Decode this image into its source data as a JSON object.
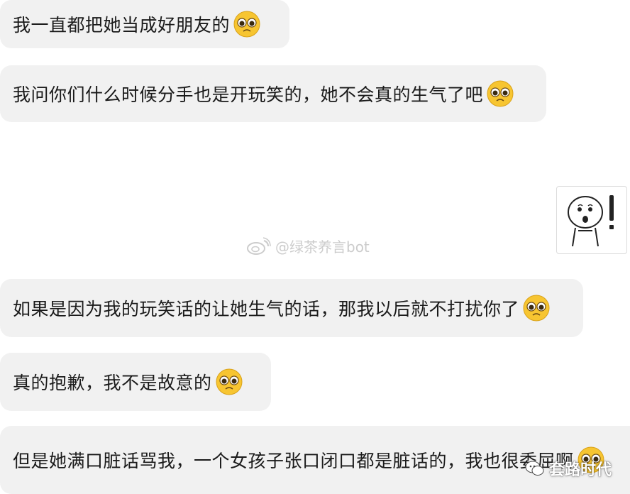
{
  "messages": [
    {
      "text": "我一直都把她当成好朋友的",
      "emoji": "crying-emoji"
    },
    {
      "text": "我问你们什么时候分手也是开玩笑的，她不会真的生气了吧",
      "emoji": "crying-emoji"
    },
    {
      "text": "如果是因为我的玩笑话的让她生气的话，那我以后就不打扰你了",
      "emoji": "crying-emoji"
    },
    {
      "text": "真的抱歉，我不是故意的",
      "emoji": "crying-emoji"
    },
    {
      "text": "但是她满口脏话骂我，一个女孩子张口闭口都是脏话的，我也很委屈啊",
      "emoji": "crying-emoji"
    }
  ],
  "sticker": {
    "icon": "shocked-face-sticker"
  },
  "watermarks": {
    "weibo": {
      "icon": "weibo-icon",
      "text": "@绿茶养言bot"
    },
    "wechat": {
      "icon": "wechat-icon",
      "text": "套路时代"
    }
  },
  "colors": {
    "bubble_bg": "#f1f1f1",
    "text": "#1a1a1a",
    "emoji_face": "#f7c531"
  }
}
